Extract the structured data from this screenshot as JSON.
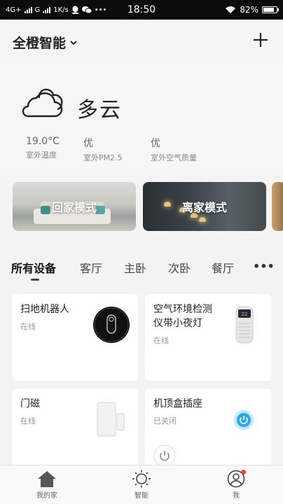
{
  "status_bar": {
    "network": "4G+",
    "network2": "G",
    "speed": "1K/s",
    "time": "18:50",
    "battery": "82%",
    "battery_level": 0.82
  },
  "header": {
    "title": "全橙智能",
    "dropdown_icon": "chevron-down-icon",
    "add_icon": "plus-icon"
  },
  "weather": {
    "icon": "cloud-icon",
    "condition": "多云",
    "stats": [
      {
        "value": "19.0°C",
        "label": "室外温度"
      },
      {
        "value": "优",
        "label": "室外PM2.5"
      },
      {
        "value": "优",
        "label": "室外空气质量"
      }
    ]
  },
  "scenes": [
    {
      "label": "回家模式"
    },
    {
      "label": "离家模式"
    }
  ],
  "tabs": [
    "所有设备",
    "客厅",
    "主卧",
    "次卧",
    "餐厅"
  ],
  "active_tab_index": 0,
  "more_label": "•••",
  "devices": [
    {
      "name": "扫地机器人",
      "status": "在线"
    },
    {
      "name": "空气环境检测\n仪带小夜灯",
      "status": "在线"
    },
    {
      "name": "门磁",
      "status": "在线"
    },
    {
      "name": "机顶盒插座",
      "status": "已关闭"
    }
  ],
  "bottom_nav": [
    {
      "label": "我的家",
      "icon": "home-icon"
    },
    {
      "label": "智能",
      "icon": "sun-icon"
    },
    {
      "label": "我",
      "icon": "profile-icon"
    }
  ],
  "colors": {
    "accent_blue": "#29a8e8",
    "notification_red": "#ff3b30",
    "background": "#f3f3f3"
  }
}
